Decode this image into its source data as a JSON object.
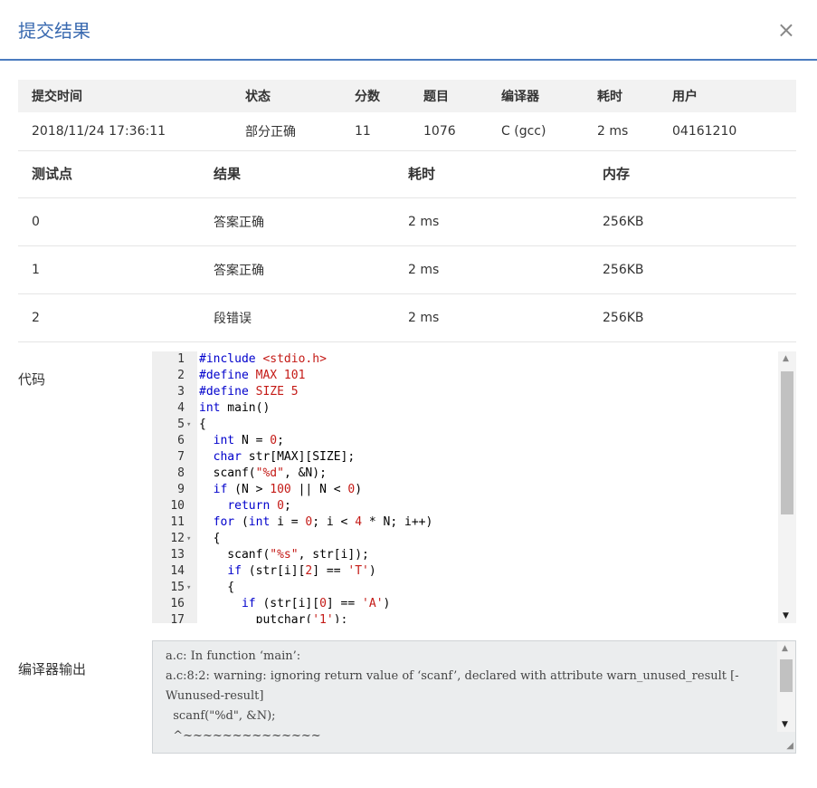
{
  "modal": {
    "title": "提交结果",
    "close": "×"
  },
  "summary": {
    "headers": [
      "提交时间",
      "状态",
      "分数",
      "题目",
      "编译器",
      "耗时",
      "用户"
    ],
    "row": [
      "2018/11/24 17:36:11",
      "部分正确",
      "11",
      "1076",
      "C (gcc)",
      "2 ms",
      "04161210"
    ]
  },
  "tests": {
    "headers": [
      "测试点",
      "结果",
      "耗时",
      "内存"
    ],
    "rows": [
      [
        "0",
        "答案正确",
        "2 ms",
        "256KB"
      ],
      [
        "1",
        "答案正确",
        "2 ms",
        "256KB"
      ],
      [
        "2",
        "段错误",
        "2 ms",
        "256KB"
      ]
    ]
  },
  "code": {
    "label": "代码",
    "lines": [
      {
        "n": "1",
        "text": "#include <stdio.h>"
      },
      {
        "n": "2",
        "text": "#define MAX 101"
      },
      {
        "n": "3",
        "text": "#define SIZE 5"
      },
      {
        "n": "4",
        "text": "int main()"
      },
      {
        "n": "5",
        "text": "{"
      },
      {
        "n": "6",
        "text": "  int N = 0;"
      },
      {
        "n": "7",
        "text": "  char str[MAX][SIZE];"
      },
      {
        "n": "8",
        "text": "  scanf(\"%d\", &N);"
      },
      {
        "n": "9",
        "text": "  if (N > 100 || N < 0)"
      },
      {
        "n": "10",
        "text": "    return 0;"
      },
      {
        "n": "11",
        "text": "  for (int i = 0; i < 4 * N; i++)"
      },
      {
        "n": "12",
        "text": "  {"
      },
      {
        "n": "13",
        "text": "    scanf(\"%s\", str[i]);"
      },
      {
        "n": "14",
        "text": "    if (str[i][2] == 'T')"
      },
      {
        "n": "15",
        "text": "    {"
      },
      {
        "n": "16",
        "text": "      if (str[i][0] == 'A')"
      },
      {
        "n": "17",
        "text": "        putchar('1');"
      }
    ]
  },
  "compiler_output": {
    "label": "编译器输出",
    "lines": [
      "a.c: In function ‘main’:",
      "a.c:8:2: warning: ignoring return value of ‘scanf’, declared with attribute warn_unused_result [-Wunused-result]",
      "  scanf(\"%d\", &N);",
      "  ^~~~~~~~~~~~~~~"
    ]
  }
}
